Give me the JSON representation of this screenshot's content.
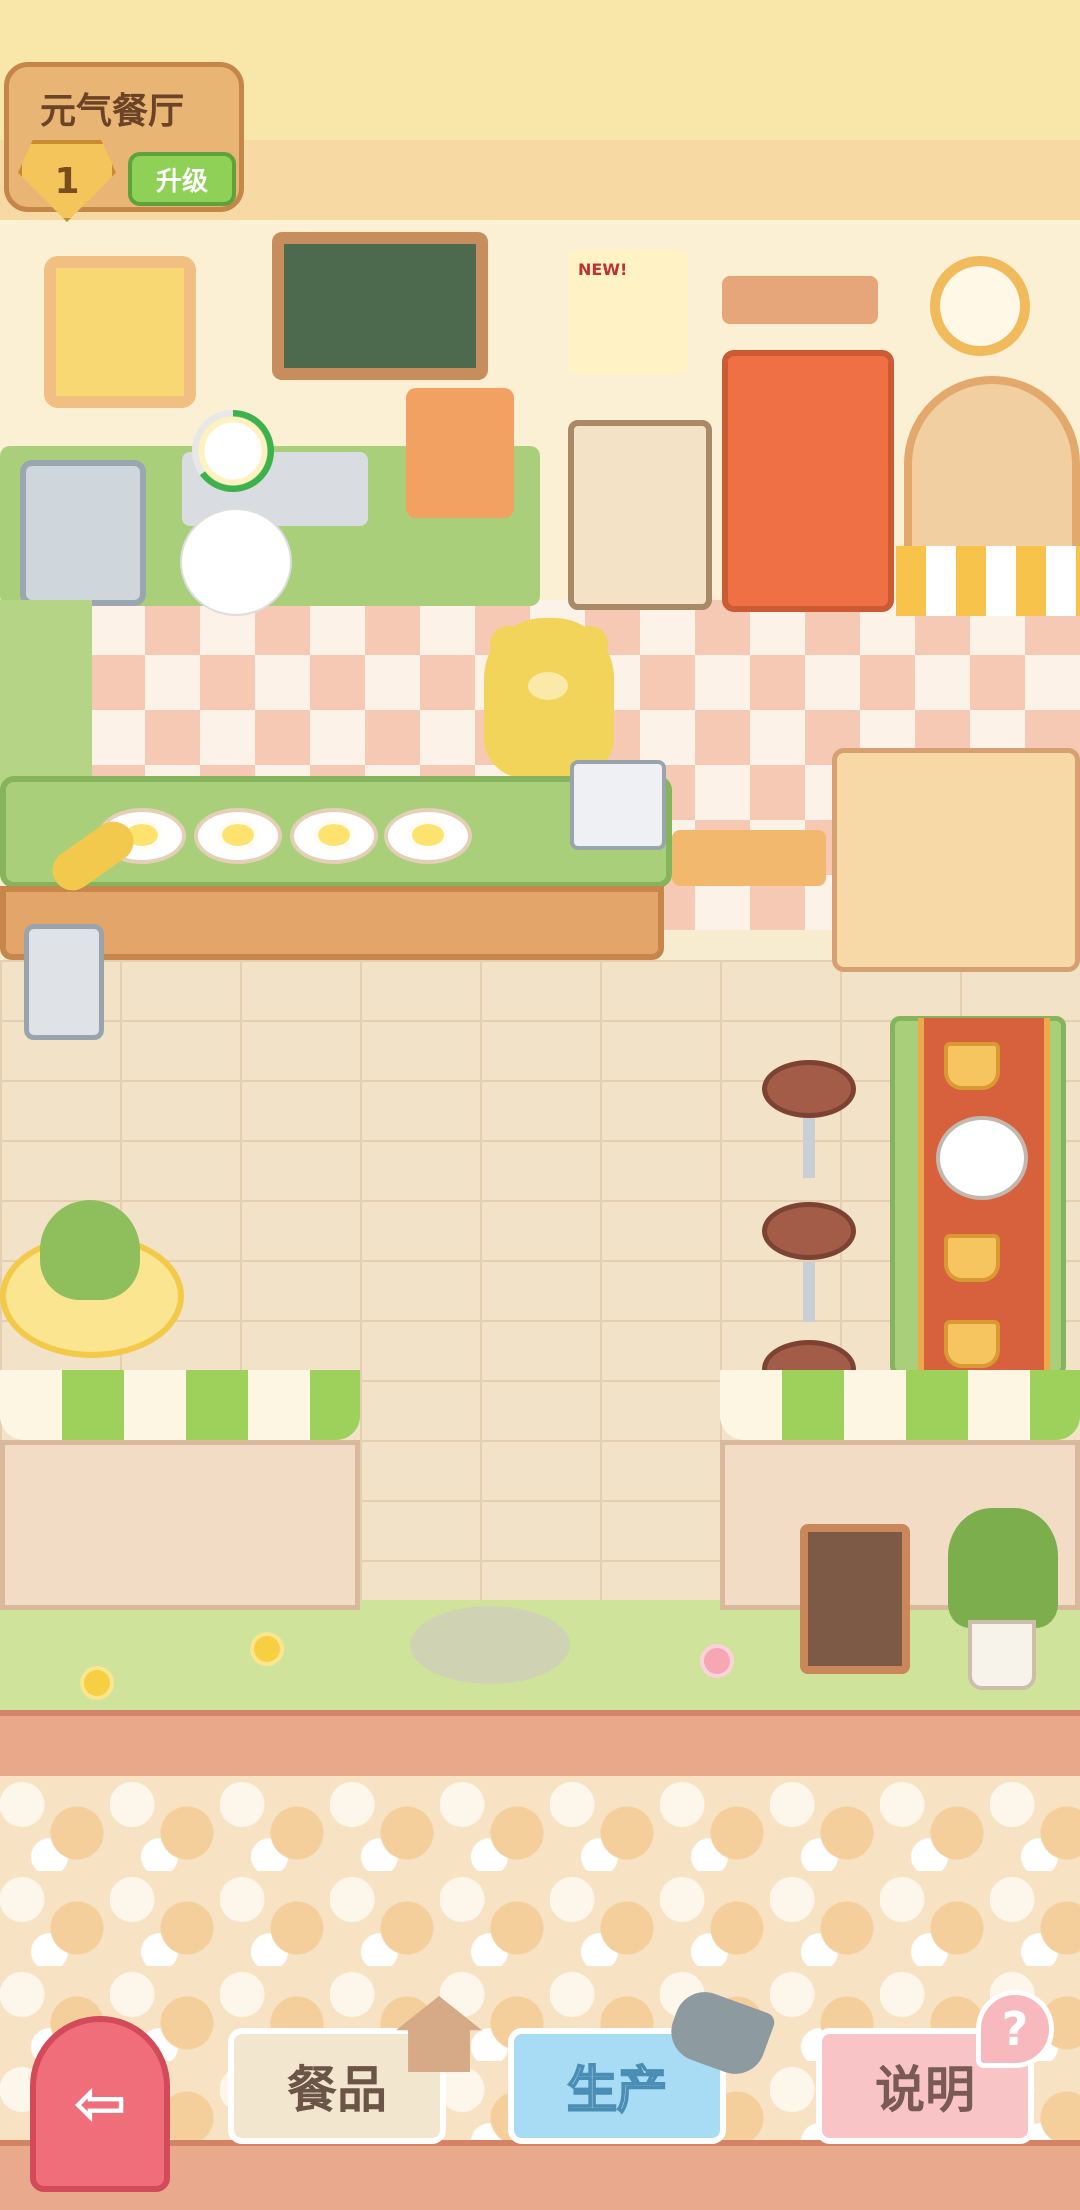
{
  "header": {
    "restaurant_name": "元气餐厅",
    "level": "1",
    "upgrade_label": "升级"
  },
  "scene": {
    "poster_badge": "NEW!",
    "cook_progress": 0.65
  },
  "bottom_nav": {
    "meals_label": "餐品",
    "production_label": "生产",
    "help_label": "说明",
    "help_icon_glyph": "?",
    "exit_icon_glyph": "⇦"
  },
  "icons": {
    "exit": "exit-door-arrow-icon",
    "meals": "house-icon",
    "production": "frying-pan-icon",
    "help": "question-bubble-icon"
  },
  "colors": {
    "upgrade_green": "#8ed156",
    "exit_red": "#f06d7a",
    "production_blue": "#a7dcf4",
    "help_pink": "#f8c4c6"
  }
}
